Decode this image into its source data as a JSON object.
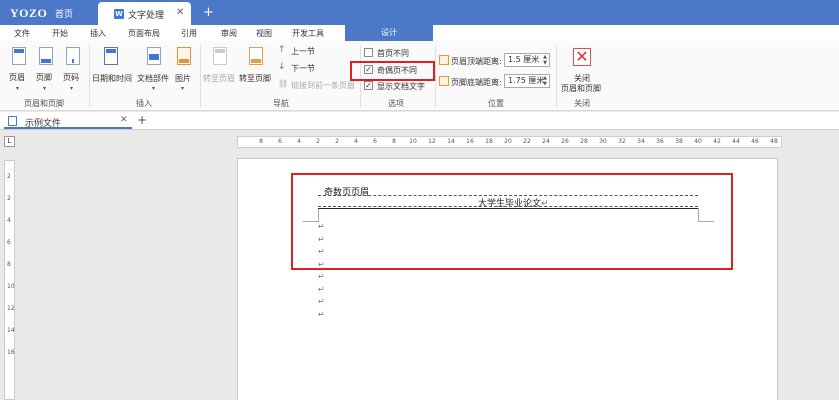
{
  "app": {
    "logo": "YOZO",
    "home_tab": "首页",
    "doc_tab": "文字处理",
    "doc_tab_icon": "W"
  },
  "menu": {
    "items": [
      "文件",
      "开始",
      "插入",
      "页面布局",
      "引用",
      "审阅",
      "视图",
      "开发工具"
    ],
    "active": "设计"
  },
  "ribbon": {
    "header_footer": {
      "header": "页眉",
      "footer": "页脚",
      "page_number": "页码",
      "group": "页眉和页脚"
    },
    "insert": {
      "datetime": "日期和时间",
      "doc_parts": "文档部件",
      "picture": "图片",
      "group": "插入"
    },
    "navigation": {
      "goto_header": "转至页眉",
      "goto_footer": "转至页脚",
      "previous": "上一节",
      "next": "下一节",
      "link_previous": "链接到前一条页眉",
      "group": "导航"
    },
    "options": {
      "different_first": "首页不同",
      "different_odd_even": "奇偶页不同",
      "show_doc_text": "显示文档文字",
      "different_first_checked": false,
      "different_odd_even_checked": true,
      "show_doc_text_checked": true,
      "group": "选项"
    },
    "position": {
      "header_label": "页眉顶端距离:",
      "header_value": "1.5 厘米",
      "footer_label": "页脚底端距离:",
      "footer_value": "1.75 厘米",
      "group": "位置"
    },
    "close": {
      "label_line1": "关闭",
      "label_line2": "页眉和页脚",
      "group": "关闭"
    }
  },
  "file_tab": {
    "label": "示例文件"
  },
  "ruler": {
    "corner": "L",
    "h_ticks": [
      "8",
      "6",
      "4",
      "2",
      "2",
      "4",
      "6",
      "8",
      "10",
      "12",
      "14",
      "16",
      "18",
      "20",
      "22",
      "24",
      "26",
      "28",
      "30",
      "32",
      "34",
      "36",
      "38",
      "40",
      "42",
      "44",
      "46",
      "48"
    ],
    "v_ticks": [
      "2",
      "2",
      "4",
      "6",
      "8",
      "10",
      "12",
      "14",
      "16"
    ]
  },
  "document": {
    "header_label": "奇数页页眉",
    "header_text": "大学生毕业论文",
    "para_mark": "↵"
  },
  "colors": {
    "title_bar": "#4b79c7",
    "highlight": "#e02020"
  }
}
